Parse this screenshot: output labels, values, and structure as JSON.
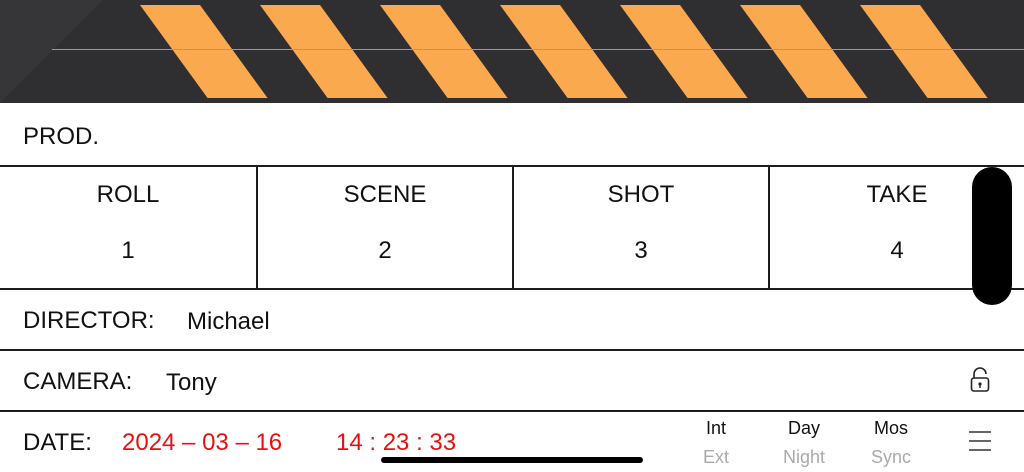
{
  "slate": {
    "prod_label": "PROD.",
    "prod_value": "",
    "roll_label": "ROLL",
    "roll_value": "1",
    "scene_label": "SCENE",
    "scene_value": "2",
    "shot_label": "SHOT",
    "shot_value": "3",
    "take_label": "TAKE",
    "take_value": "4",
    "director_label": "DIRECTOR:",
    "director_value": "Michael",
    "camera_label": "CAMERA:",
    "camera_value": "Tony",
    "date_label": "DATE:",
    "date_value": "2024 – 03 – 16",
    "time_value": "14 : 23 : 33"
  },
  "toggles": [
    {
      "on": "Int",
      "off": "Ext"
    },
    {
      "on": "Day",
      "off": "Night"
    },
    {
      "on": "Mos",
      "off": "Sync"
    }
  ],
  "icons": {
    "lock": "lock-open-icon",
    "menu": "hamburger-menu-icon"
  },
  "colors": {
    "clapper_bg": "#2f2f31",
    "stripe": "#fba94f",
    "date_time": "#e81010"
  }
}
